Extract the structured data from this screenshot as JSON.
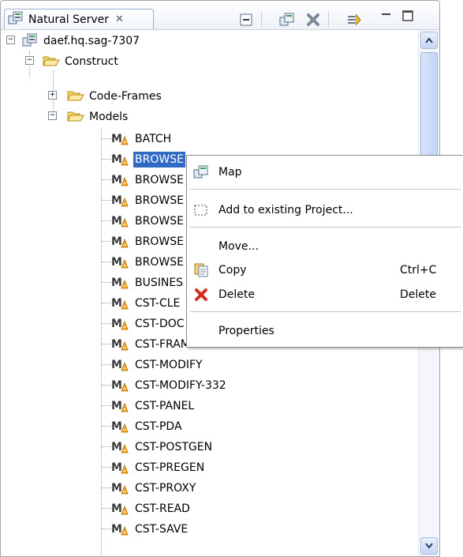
{
  "view": {
    "tab_title": "Natural Server",
    "close_glyph": "✕"
  },
  "toolbar": {
    "icons": [
      "collapse-all-icon",
      "server-map-icon",
      "delete-icon",
      "link-with-editor-icon",
      "minimize-icon",
      "maximize-icon"
    ]
  },
  "tree": {
    "server": "daef.hq.sag-7307",
    "construct": "Construct",
    "code_frames": "Code-Frames",
    "models_folder": "Models",
    "models": [
      "BATCH",
      "BROWSE",
      "BROWSE",
      "BROWSE",
      "BROWSE",
      "BROWSE",
      "BROWSE",
      "BUSINES",
      "CST-CLE",
      "CST-DOC",
      "CST-FRAME",
      "CST-MODIFY",
      "CST-MODIFY-332",
      "CST-PANEL",
      "CST-PDA",
      "CST-POSTGEN",
      "CST-PREGEN",
      "CST-PROXY",
      "CST-READ",
      "CST-SAVE"
    ],
    "selected_index": 1
  },
  "context_menu": {
    "map": "Map",
    "add_to_project": "Add to existing Project...",
    "move": "Move...",
    "copy": "Copy",
    "copy_shortcut": "Ctrl+C",
    "delete": "Delete",
    "delete_shortcut": "Delete",
    "properties": "Properties"
  },
  "colors": {
    "selection": "#316ac5",
    "delete_red": "#d62b1f",
    "folder_yellow": "#f6d76b"
  }
}
